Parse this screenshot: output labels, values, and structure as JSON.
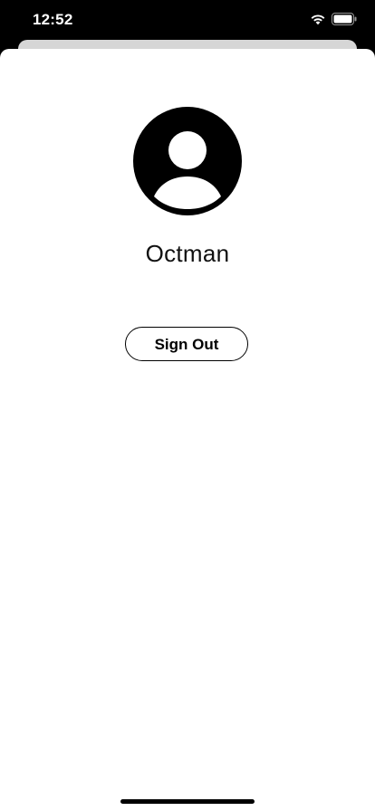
{
  "status_bar": {
    "time": "12:52",
    "icons": [
      "wifi-icon",
      "battery-icon"
    ]
  },
  "profile": {
    "avatar_icon": "person-circle-icon",
    "display_name": "Octman"
  },
  "actions": {
    "sign_out_label": "Sign Out"
  },
  "colors": {
    "background": "#ffffff",
    "status_bar": "#000000",
    "text": "#111111",
    "button_border": "#000000"
  }
}
